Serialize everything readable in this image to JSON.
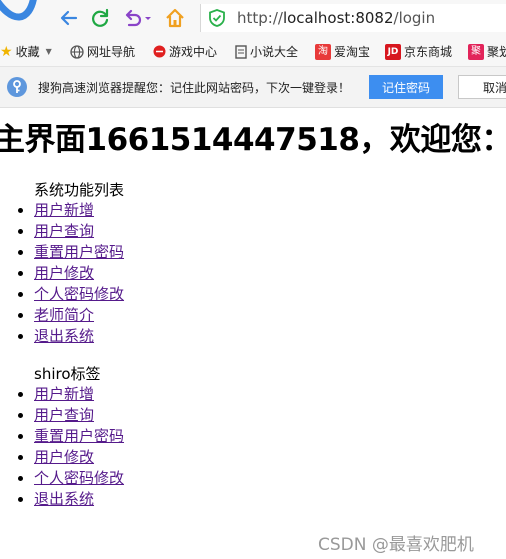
{
  "browser": {
    "url_prefix": "http://",
    "url_host": "localhost:8082",
    "url_path": "/login"
  },
  "bookmarks": [
    {
      "label": "收藏",
      "icon": "star-icon"
    },
    {
      "label": "网址导航",
      "icon": "globe-icon"
    },
    {
      "label": "游戏中心",
      "icon": "game-icon"
    },
    {
      "label": "小说大全",
      "icon": "book-icon"
    },
    {
      "label": "爱淘宝",
      "icon": "taobao-icon"
    },
    {
      "label": "京东商城",
      "icon": "jd-icon"
    },
    {
      "label": "聚划",
      "icon": "juhuasuan-icon"
    }
  ],
  "notification": {
    "text": "搜狗高速浏览器提醒您：记住此网站密码，下次一键登录！",
    "remember_label": "记住密码",
    "cancel_label": "取消"
  },
  "page": {
    "title": "主界面1661514447518，欢迎您：",
    "section1_label": "系统功能列表",
    "section1_links": [
      "用户新增",
      "用户查询",
      "重置用户密码",
      "用户修改",
      "个人密码修改",
      "老师简介",
      "退出系统"
    ],
    "section2_label": "shiro标签",
    "section2_links": [
      "用户新增",
      "用户查询",
      "重置用户密码",
      "用户修改",
      "个人密码修改",
      "退出系统"
    ]
  },
  "watermark": "CSDN @最喜欢肥机",
  "colors": {
    "link_visited": "#551a8b",
    "accent_button": "#3d8ef0",
    "nav_back": "#3a86e0",
    "nav_refresh": "#1fa843",
    "nav_undo": "#8a44c8",
    "nav_home": "#f0a020",
    "shield": "#2ab14b"
  }
}
